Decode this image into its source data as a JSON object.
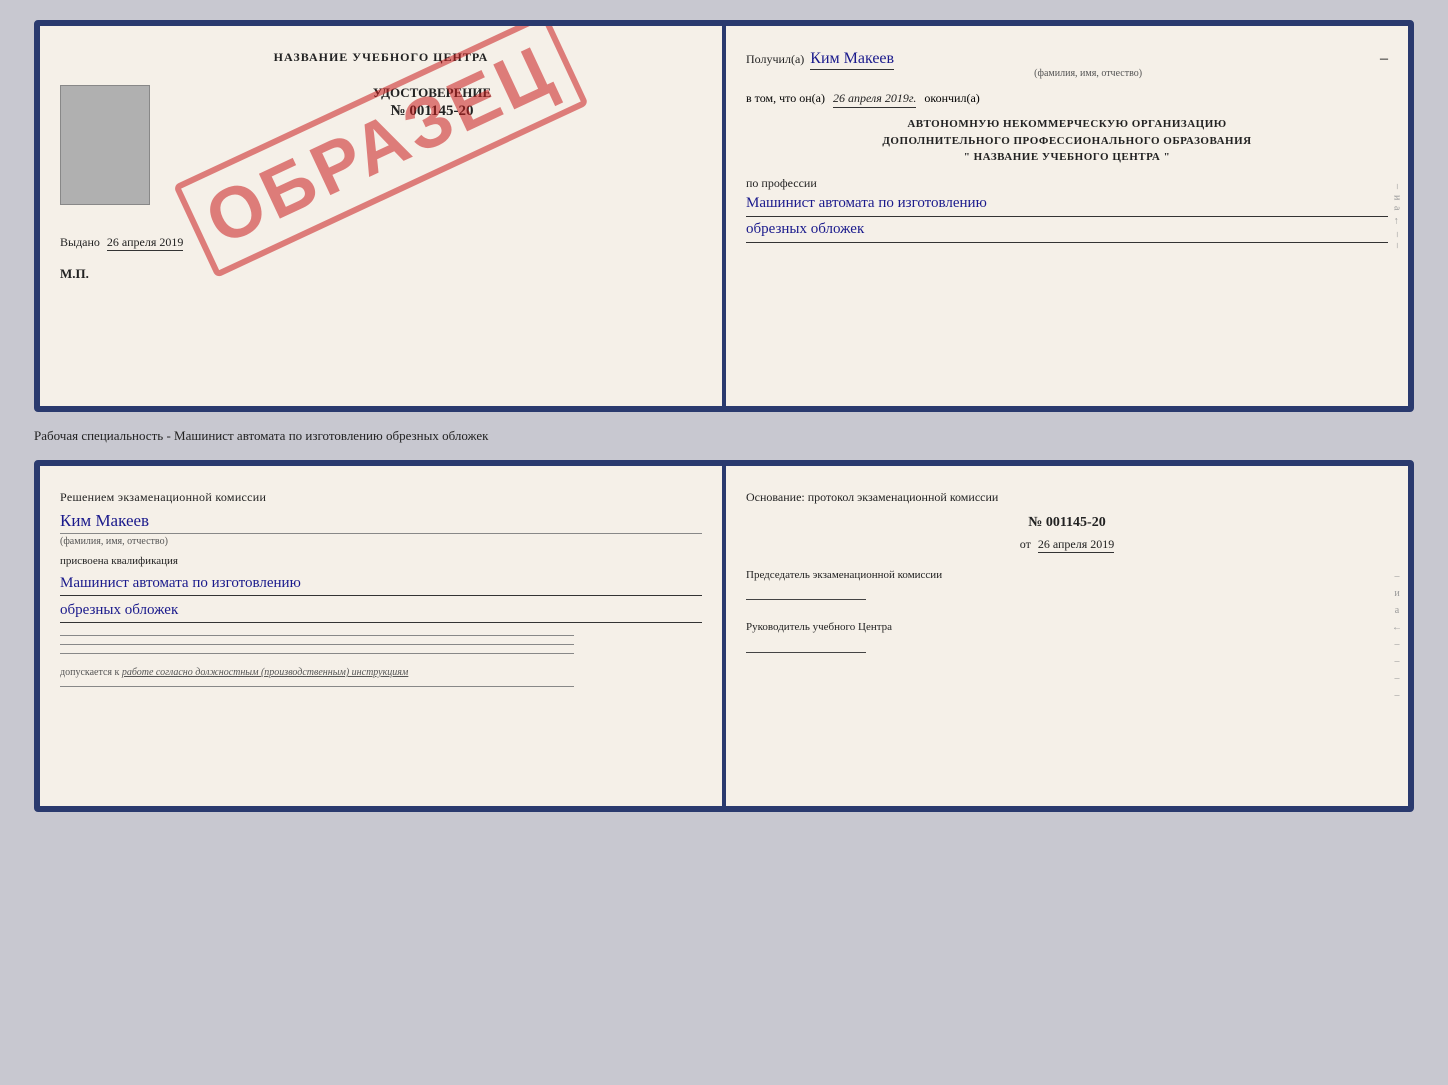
{
  "top_doc": {
    "left": {
      "title": "НАЗВАНИЕ УЧЕБНОГО ЦЕНТРА",
      "watermark": "ОБРАЗЕЦ",
      "udost_label": "УДОСТОВЕРЕНИЕ",
      "udost_number": "№ 001145-20",
      "vydano_label": "Выдано",
      "vydano_date": "26 апреля 2019",
      "mp_label": "М.П."
    },
    "right": {
      "poluchil_label": "Получил(а)",
      "recipient_name": "Ким Макеев",
      "fio_sub": "(фамилия, имя, отчество)",
      "vtom_label": "в том, что он(а)",
      "date_val": "26 апреля 2019г.",
      "okonchil_label": "окончил(а)",
      "org_line1": "АВТОНОМНУЮ НЕКОММЕРЧЕСКУЮ ОРГАНИЗАЦИЮ",
      "org_line2": "ДОПОЛНИТЕЛЬНОГО ПРОФЕССИОНАЛЬНОГО ОБРАЗОВАНИЯ",
      "org_name": "\" НАЗВАНИЕ УЧЕБНОГО ЦЕНТРА \"",
      "professia_label": "по профессии",
      "professia_line1": "Машинист автомата по изготовлению",
      "professia_line2": "обрезных обложек"
    }
  },
  "middle_label": "Рабочая специальность - Машинист автомата по изготовлению обрезных обложек",
  "bottom_doc": {
    "left": {
      "komissia_text": "Решением экзаменационной комиссии",
      "candidate_name": "Ким Макеев",
      "fio_sub": "(фамилия, имя, отчество)",
      "kvalif_label": "присвоена квалификация",
      "kvalif_line1": "Машинист автомата по изготовлению",
      "kvalif_line2": "обрезных обложек",
      "dopusk_text": "допускается к",
      "dopusk_underline": "работе согласно должностным (производственным) инструкциям"
    },
    "right": {
      "osnovanie_title": "Основание: протокол экзаменационной комиссии",
      "protocol_number": "№ 001145-20",
      "ot_label": "от",
      "ot_date": "26 апреля 2019",
      "chairman_label": "Председатель экзаменационной комиссии",
      "rukovod_label": "Руководитель учебного Центра"
    },
    "right_strip": {
      "chars": [
        "и",
        "а",
        "←",
        "–",
        "–",
        "–",
        "–"
      ]
    }
  },
  "top_strip": {
    "chars": [
      "и",
      "а",
      "←",
      "–",
      "–",
      "–",
      "–"
    ]
  }
}
